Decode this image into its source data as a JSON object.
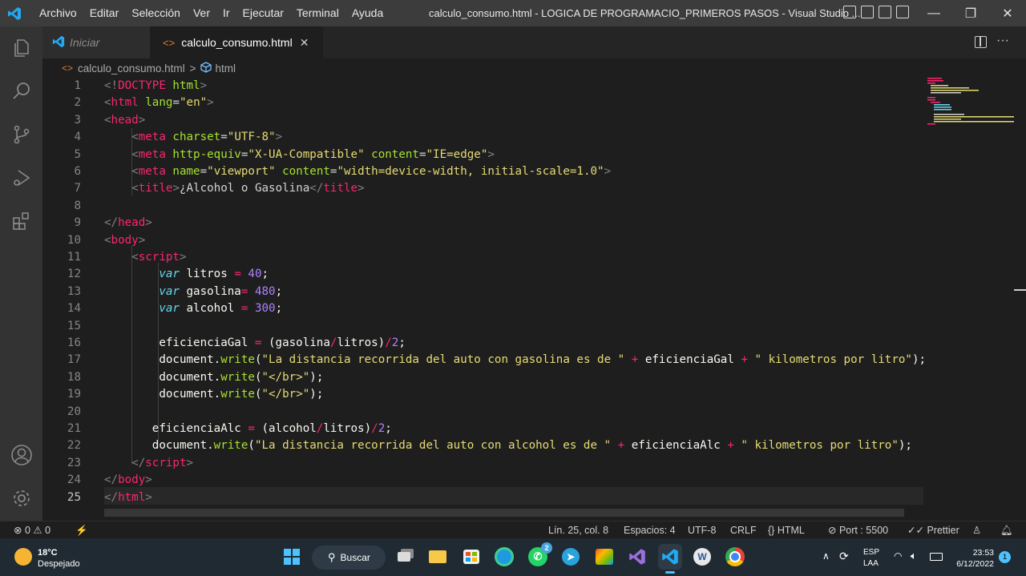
{
  "menu": [
    "Archivo",
    "Editar",
    "Selección",
    "Ver",
    "Ir",
    "Ejecutar",
    "Terminal",
    "Ayuda"
  ],
  "window_title": "calculo_consumo.html - LOGICA DE PROGRAMACIO_PRIMEROS PASOS - Visual Studio ...",
  "window_controls": {
    "minimize": "—",
    "restore": "❐",
    "close": "✕"
  },
  "activity_icons": [
    "explorer-icon",
    "search-icon",
    "source-control-icon",
    "run-debug-icon",
    "extensions-icon",
    "accounts-icon",
    "manage-gear-icon"
  ],
  "tabs": [
    {
      "label": "Iniciar",
      "active": false
    },
    {
      "label": "calculo_consumo.html",
      "active": true,
      "close": "✕"
    }
  ],
  "tab_actions": {
    "more": "···"
  },
  "breadcrumb": {
    "file": "calculo_consumo.html",
    "separator": ">",
    "symbol": "html"
  },
  "code_lines": [
    [
      {
        "t": "<!",
        "c": "p"
      },
      {
        "t": "DOCTYPE",
        "c": "tag"
      },
      {
        "t": " html",
        "c": "attr"
      },
      {
        "t": ">",
        "c": "p"
      }
    ],
    [
      {
        "t": "<",
        "c": "p"
      },
      {
        "t": "html",
        "c": "tag"
      },
      {
        "t": " lang",
        "c": "attr"
      },
      {
        "t": "=",
        "c": "txt"
      },
      {
        "t": "\"en\"",
        "c": "str"
      },
      {
        "t": ">",
        "c": "p"
      }
    ],
    [
      {
        "t": "<",
        "c": "p"
      },
      {
        "t": "head",
        "c": "tag"
      },
      {
        "t": ">",
        "c": "p"
      }
    ],
    [
      {
        "t": "    <",
        "c": "p"
      },
      {
        "t": "meta",
        "c": "tag"
      },
      {
        "t": " charset",
        "c": "attr"
      },
      {
        "t": "=",
        "c": "txt"
      },
      {
        "t": "\"UTF-8\"",
        "c": "str"
      },
      {
        "t": ">",
        "c": "p"
      }
    ],
    [
      {
        "t": "    <",
        "c": "p"
      },
      {
        "t": "meta",
        "c": "tag"
      },
      {
        "t": " http-equiv",
        "c": "attr"
      },
      {
        "t": "=",
        "c": "txt"
      },
      {
        "t": "\"X-UA-Compatible\"",
        "c": "str"
      },
      {
        "t": " content",
        "c": "attr"
      },
      {
        "t": "=",
        "c": "txt"
      },
      {
        "t": "\"IE=edge\"",
        "c": "str"
      },
      {
        "t": ">",
        "c": "p"
      }
    ],
    [
      {
        "t": "    <",
        "c": "p"
      },
      {
        "t": "meta",
        "c": "tag"
      },
      {
        "t": " name",
        "c": "attr"
      },
      {
        "t": "=",
        "c": "txt"
      },
      {
        "t": "\"viewport\"",
        "c": "str"
      },
      {
        "t": " content",
        "c": "attr"
      },
      {
        "t": "=",
        "c": "txt"
      },
      {
        "t": "\"width=device-width, initial-scale=1.0\"",
        "c": "str"
      },
      {
        "t": ">",
        "c": "p"
      }
    ],
    [
      {
        "t": "    <",
        "c": "p"
      },
      {
        "t": "title",
        "c": "tag"
      },
      {
        "t": ">",
        "c": "p"
      },
      {
        "t": "¿Alcohol o Gasolina",
        "c": "txt"
      },
      {
        "t": "</",
        "c": "p"
      },
      {
        "t": "title",
        "c": "tag"
      },
      {
        "t": ">",
        "c": "p"
      }
    ],
    [],
    [
      {
        "t": "</",
        "c": "p"
      },
      {
        "t": "head",
        "c": "tag"
      },
      {
        "t": ">",
        "c": "p"
      }
    ],
    [
      {
        "t": "<",
        "c": "p"
      },
      {
        "t": "body",
        "c": "tag"
      },
      {
        "t": ">",
        "c": "p"
      }
    ],
    [
      {
        "t": "    <",
        "c": "p"
      },
      {
        "t": "script",
        "c": "tag"
      },
      {
        "t": ">",
        "c": "p"
      }
    ],
    [
      {
        "t": "        ",
        "c": "txt"
      },
      {
        "t": "var",
        "c": "kw"
      },
      {
        "t": " litros ",
        "c": "id"
      },
      {
        "t": "=",
        "c": "op"
      },
      {
        "t": " ",
        "c": "id"
      },
      {
        "t": "40",
        "c": "num"
      },
      {
        "t": ";",
        "c": "id"
      }
    ],
    [
      {
        "t": "        ",
        "c": "txt"
      },
      {
        "t": "var",
        "c": "kw"
      },
      {
        "t": " gasolina",
        "c": "id"
      },
      {
        "t": "=",
        "c": "op"
      },
      {
        "t": " ",
        "c": "id"
      },
      {
        "t": "480",
        "c": "num"
      },
      {
        "t": ";",
        "c": "id"
      }
    ],
    [
      {
        "t": "        ",
        "c": "txt"
      },
      {
        "t": "var",
        "c": "kw"
      },
      {
        "t": " alcohol ",
        "c": "id"
      },
      {
        "t": "=",
        "c": "op"
      },
      {
        "t": " ",
        "c": "id"
      },
      {
        "t": "300",
        "c": "num"
      },
      {
        "t": ";",
        "c": "id"
      }
    ],
    [],
    [
      {
        "t": "        eficienciaGal ",
        "c": "id"
      },
      {
        "t": "=",
        "c": "op"
      },
      {
        "t": " (gasolina",
        "c": "id"
      },
      {
        "t": "/",
        "c": "op"
      },
      {
        "t": "litros)",
        "c": "id"
      },
      {
        "t": "/",
        "c": "op"
      },
      {
        "t": "2",
        "c": "num"
      },
      {
        "t": ";",
        "c": "id"
      }
    ],
    [
      {
        "t": "        document.",
        "c": "id"
      },
      {
        "t": "write",
        "c": "fn"
      },
      {
        "t": "(",
        "c": "id"
      },
      {
        "t": "\"La distancia recorrida del auto con gasolina es de \"",
        "c": "str"
      },
      {
        "t": " ",
        "c": "id"
      },
      {
        "t": "+",
        "c": "op"
      },
      {
        "t": " eficienciaGal ",
        "c": "id"
      },
      {
        "t": "+",
        "c": "op"
      },
      {
        "t": " ",
        "c": "id"
      },
      {
        "t": "\" kilometros por litro\"",
        "c": "str"
      },
      {
        "t": ");",
        "c": "id"
      }
    ],
    [
      {
        "t": "        document.",
        "c": "id"
      },
      {
        "t": "write",
        "c": "fn"
      },
      {
        "t": "(",
        "c": "id"
      },
      {
        "t": "\"</br>\"",
        "c": "str"
      },
      {
        "t": ");",
        "c": "id"
      }
    ],
    [
      {
        "t": "        document.",
        "c": "id"
      },
      {
        "t": "write",
        "c": "fn"
      },
      {
        "t": "(",
        "c": "id"
      },
      {
        "t": "\"</br>\"",
        "c": "str"
      },
      {
        "t": ");",
        "c": "id"
      }
    ],
    [],
    [
      {
        "t": "       eficienciaAlc ",
        "c": "id"
      },
      {
        "t": "=",
        "c": "op"
      },
      {
        "t": " (alcohol",
        "c": "id"
      },
      {
        "t": "/",
        "c": "op"
      },
      {
        "t": "litros)",
        "c": "id"
      },
      {
        "t": "/",
        "c": "op"
      },
      {
        "t": "2",
        "c": "num"
      },
      {
        "t": ";",
        "c": "id"
      }
    ],
    [
      {
        "t": "       document.",
        "c": "id"
      },
      {
        "t": "write",
        "c": "fn"
      },
      {
        "t": "(",
        "c": "id"
      },
      {
        "t": "\"La distancia recorrida del auto con alcohol es de \"",
        "c": "str"
      },
      {
        "t": " ",
        "c": "id"
      },
      {
        "t": "+",
        "c": "op"
      },
      {
        "t": " eficienciaAlc ",
        "c": "id"
      },
      {
        "t": "+",
        "c": "op"
      },
      {
        "t": " ",
        "c": "id"
      },
      {
        "t": "\" kilometros por litro\"",
        "c": "str"
      },
      {
        "t": ");",
        "c": "id"
      }
    ],
    [
      {
        "t": "    </",
        "c": "p"
      },
      {
        "t": "script",
        "c": "tag"
      },
      {
        "t": ">",
        "c": "p"
      }
    ],
    [
      {
        "t": "</",
        "c": "p"
      },
      {
        "t": "body",
        "c": "tag"
      },
      {
        "t": ">",
        "c": "p"
      }
    ],
    [
      {
        "t": "</",
        "c": "p"
      },
      {
        "t": "html",
        "c": "tag"
      },
      {
        "t": ">",
        "c": "p"
      }
    ]
  ],
  "status": {
    "errors": "0",
    "warnings": "0",
    "position": "Lín. 25, col. 8",
    "spaces": "Espacios: 4",
    "encoding": "UTF-8",
    "eol": "CRLF",
    "language": "HTML",
    "port": "Port : 5500",
    "prettier": "Prettier"
  },
  "taskbar": {
    "weather_temp": "18°C",
    "weather_desc": "Despejado",
    "search": "Buscar",
    "whatsapp_badge": "2",
    "lang_top": "ESP",
    "lang_bottom": "LAA",
    "time": "23:53",
    "date": "6/12/2022",
    "notifications": "1"
  },
  "colors": {
    "accent": "#0078d4",
    "titlebar": "#3c3c3c",
    "activitybar": "#333333",
    "editor": "#1e1e1e"
  }
}
